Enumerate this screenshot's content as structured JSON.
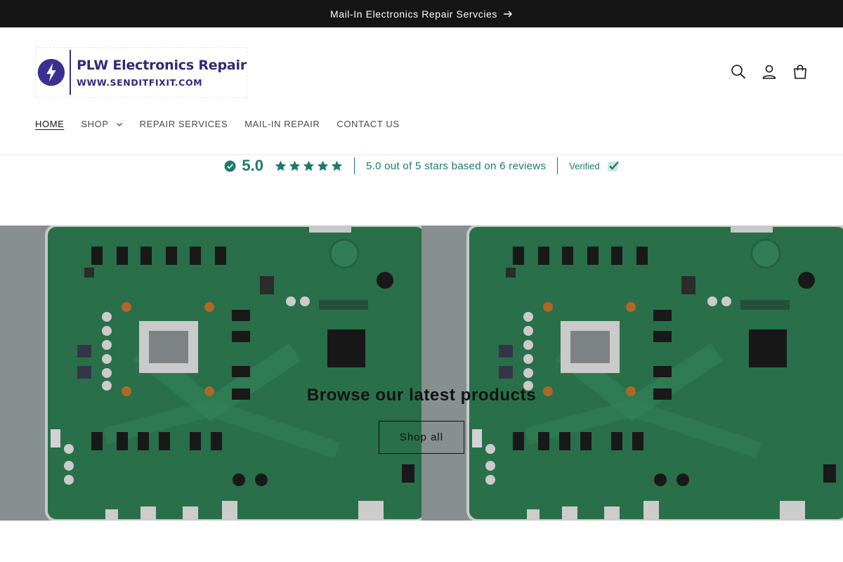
{
  "announcement": {
    "text": "Mail-In Electronics Repair Servcies",
    "icon": "arrow-right-icon"
  },
  "logo": {
    "name": "PLW Electronics Repair",
    "url_text": "WWW.SENDITFIXIT.COM",
    "color": "#2e2a7a"
  },
  "header_icons": [
    "search-icon",
    "account-icon",
    "cart-icon"
  ],
  "nav": {
    "items": [
      {
        "label": "HOME",
        "active": true
      },
      {
        "label": "SHOP",
        "dropdown": true
      },
      {
        "label": "REPAIR SERVICES"
      },
      {
        "label": "MAIL-IN REPAIR"
      },
      {
        "label": "CONTACT US"
      }
    ]
  },
  "reviews": {
    "score": "5.0",
    "stars": 5,
    "summary": "5.0 out of 5 stars based on 6 reviews",
    "verified_label": "Verified",
    "accent": "#1b7a6e"
  },
  "hero": {
    "title": "Browse our latest products",
    "button_label": "Shop all"
  }
}
